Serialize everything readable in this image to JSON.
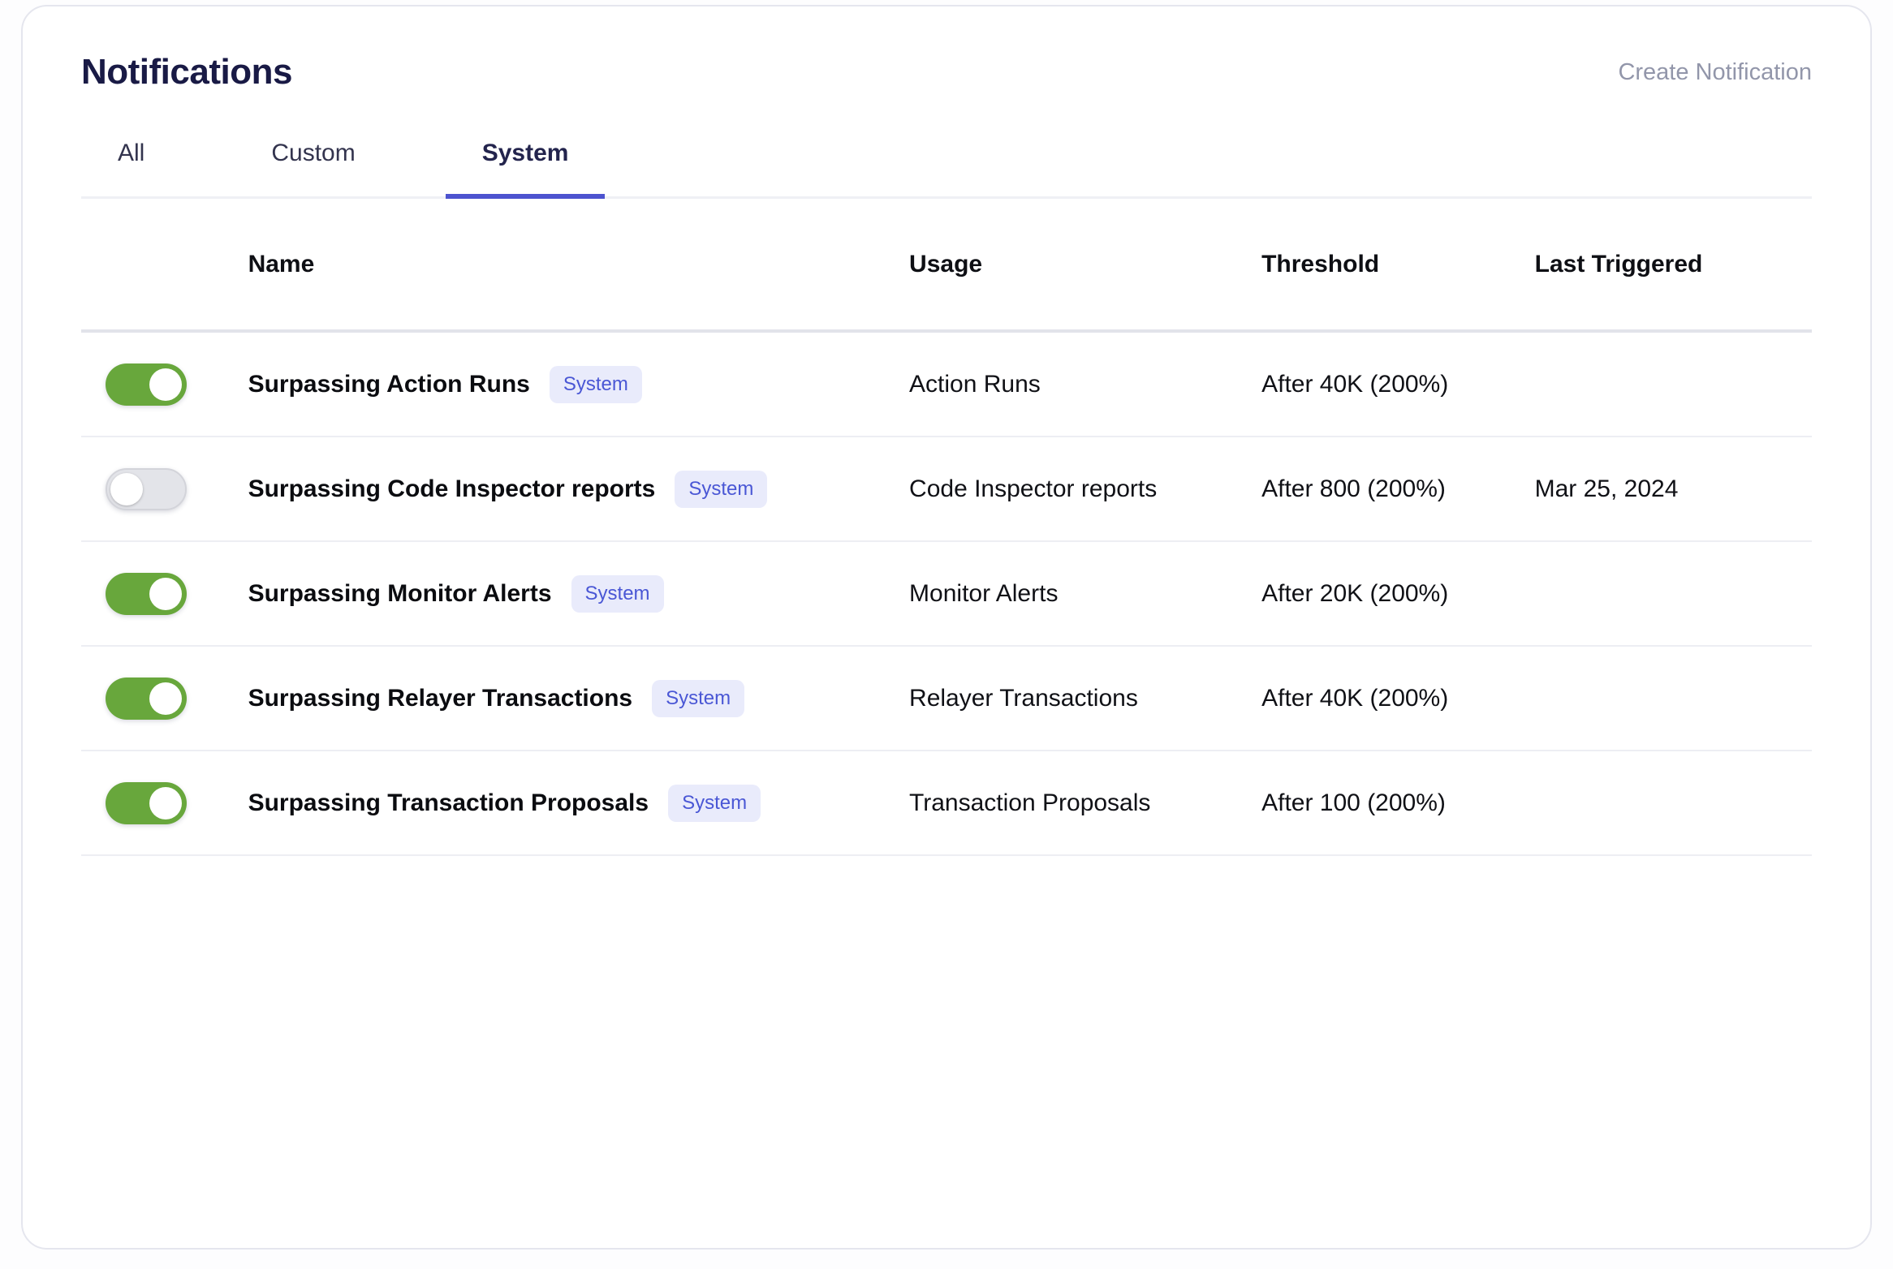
{
  "page": {
    "title": "Notifications",
    "create_button_label": "Create Notification"
  },
  "tabs": [
    {
      "label": "All",
      "active": false
    },
    {
      "label": "Custom",
      "active": false
    },
    {
      "label": "System",
      "active": true
    }
  ],
  "table": {
    "columns": [
      "Name",
      "Usage",
      "Threshold",
      "Last Triggered"
    ],
    "rows": [
      {
        "enabled": true,
        "name": "Surpassing Action Runs",
        "badge": "System",
        "usage": "Action Runs",
        "threshold": "After 40K (200%)",
        "last_triggered": ""
      },
      {
        "enabled": false,
        "name": "Surpassing Code Inspector reports",
        "badge": "System",
        "usage": "Code Inspector reports",
        "threshold": "After 800 (200%)",
        "last_triggered": "Mar 25, 2024"
      },
      {
        "enabled": true,
        "name": "Surpassing Monitor Alerts",
        "badge": "System",
        "usage": "Monitor Alerts",
        "threshold": "After 20K (200%)",
        "last_triggered": ""
      },
      {
        "enabled": true,
        "name": "Surpassing Relayer Transactions",
        "badge": "System",
        "usage": "Relayer Transactions",
        "threshold": "After 40K (200%)",
        "last_triggered": ""
      },
      {
        "enabled": true,
        "name": "Surpassing Transaction Proposals",
        "badge": "System",
        "usage": "Transaction Proposals",
        "threshold": "After 100 (200%)",
        "last_triggered": ""
      }
    ]
  },
  "colors": {
    "accent_indigo": "#4d53cf",
    "toggle_on_green": "#68a73c",
    "toggle_off_gray": "#e3e4e9",
    "badge_bg": "#e9ebfb",
    "badge_text": "#4a57d5",
    "title_navy": "#191a45",
    "muted_gray": "#9296aa"
  }
}
